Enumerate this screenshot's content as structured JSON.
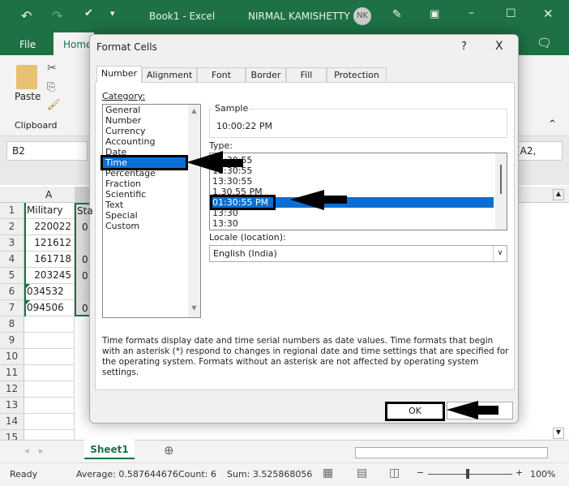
{
  "titlebar": {
    "doc_title": "Book1  -  Excel",
    "user": "NIRMAL KAMISHETTY",
    "avatar": "NK"
  },
  "ribbon": {
    "tabs": [
      "File",
      "Home"
    ],
    "paste": "Paste",
    "clipboard": "Clipboard"
  },
  "formula": {
    "name_box": "B2",
    "formula_tail": "(A2,"
  },
  "sheet": {
    "columns": [
      "A"
    ],
    "rows": [
      "1",
      "2",
      "3",
      "4",
      "5",
      "6",
      "7",
      "8",
      "9",
      "10",
      "11",
      "12",
      "13",
      "14",
      "15"
    ],
    "a_values": [
      "Military",
      "220022",
      "121612",
      "161718",
      "203245",
      "034532",
      "094506"
    ],
    "b_header": "Sta",
    "b_partial": [
      "0",
      "",
      "0",
      "0",
      "",
      "0"
    ]
  },
  "dialog": {
    "title": "Format Cells",
    "help": "?",
    "close": "X",
    "tabs": [
      "Number",
      "Alignment",
      "Font",
      "Border",
      "Fill",
      "Protection"
    ],
    "category_label": "Category:",
    "categories": [
      "General",
      "Number",
      "Currency",
      "Accounting",
      "Date",
      "Time",
      "Percentage",
      "Fraction",
      "Scientific",
      "Text",
      "Special",
      "Custom"
    ],
    "selected_category": "Time",
    "sample_label": "Sample",
    "sample_value": "10:00:22 PM",
    "type_label": "Type:",
    "types": [
      "13:30:55",
      "13:30:55",
      "13:30:55",
      "1.30.55 PM",
      "01:30:55 PM",
      "13:30",
      "13:30"
    ],
    "selected_type": "01:30:55 PM",
    "locale_label": "Locale (location):",
    "locale_value": "English (India)",
    "description": "Time formats display date and time serial numbers as date values.  Time formats that begin with an asterisk (*) respond to changes in regional date and time settings that are specified for the operating system. Formats without an asterisk are not affected by operating system settings.",
    "ok": "OK"
  },
  "sheet_tabs": {
    "active": "Sheet1"
  },
  "status": {
    "ready": "Ready",
    "average": "Average: 0.587644676",
    "count": "Count: 6",
    "sum": "Sum: 3.525868056",
    "zoom": "100%"
  },
  "colors": {
    "excel_green": "#1e7145",
    "selection_blue": "#0a6fd4"
  }
}
